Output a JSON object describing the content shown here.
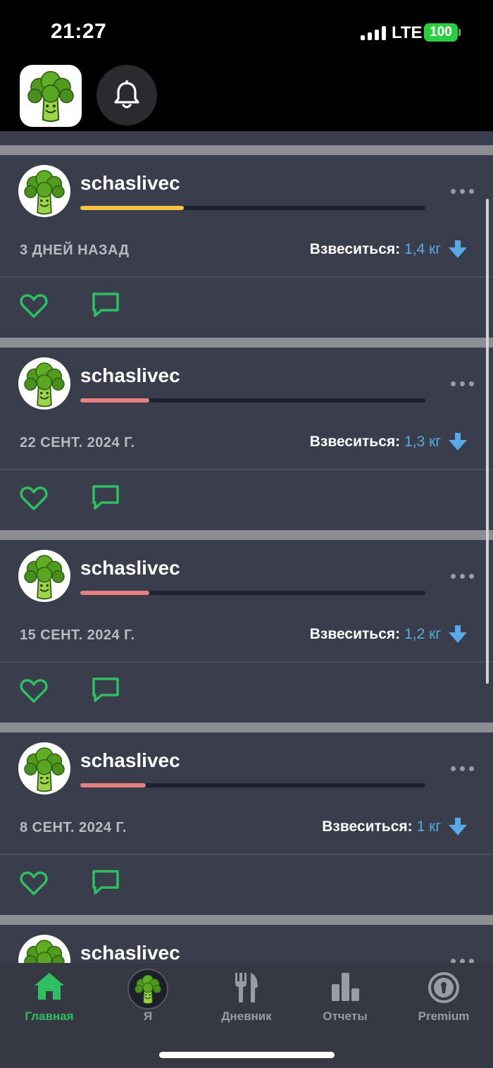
{
  "status_bar": {
    "time": "21:27",
    "network": "LTE",
    "battery": "100"
  },
  "header": {
    "logo_icon": "broccoli-logo-icon",
    "notifications_icon": "bell-icon"
  },
  "colors": {
    "accent_green": "#2fbf63",
    "weight_blue": "#55aee0",
    "progress_yellow": "#f5c242",
    "progress_red": "#e98080"
  },
  "posts": [
    {
      "username": "schaslivec",
      "date": "3 ДНЕЙ НАЗАД",
      "weight_label": "Взвеситься:",
      "weight_value": "1,4 кг",
      "progress": 0.3,
      "progress_color": "#f5c242"
    },
    {
      "username": "schaslivec",
      "date": "22 СЕНТ. 2024 Г.",
      "weight_label": "Взвеситься:",
      "weight_value": "1,3 кг",
      "progress": 0.2,
      "progress_color": "#e98080"
    },
    {
      "username": "schaslivec",
      "date": "15 СЕНТ. 2024 Г.",
      "weight_label": "Взвеситься:",
      "weight_value": "1,2 кг",
      "progress": 0.2,
      "progress_color": "#e98080"
    },
    {
      "username": "schaslivec",
      "date": "8 СЕНТ. 2024 Г.",
      "weight_label": "Взвеситься:",
      "weight_value": "1 кг",
      "progress": 0.19,
      "progress_color": "#e98080"
    },
    {
      "username": "schaslivec"
    }
  ],
  "tabs": [
    {
      "label": "Главная",
      "icon": "home-icon",
      "active": true
    },
    {
      "label": "Я",
      "icon": "avatar-icon",
      "active": false
    },
    {
      "label": "Дневник",
      "icon": "fork-knife-icon",
      "active": false
    },
    {
      "label": "Отчеты",
      "icon": "bar-chart-icon",
      "active": false
    },
    {
      "label": "Premium",
      "icon": "premium-icon",
      "active": false
    }
  ]
}
